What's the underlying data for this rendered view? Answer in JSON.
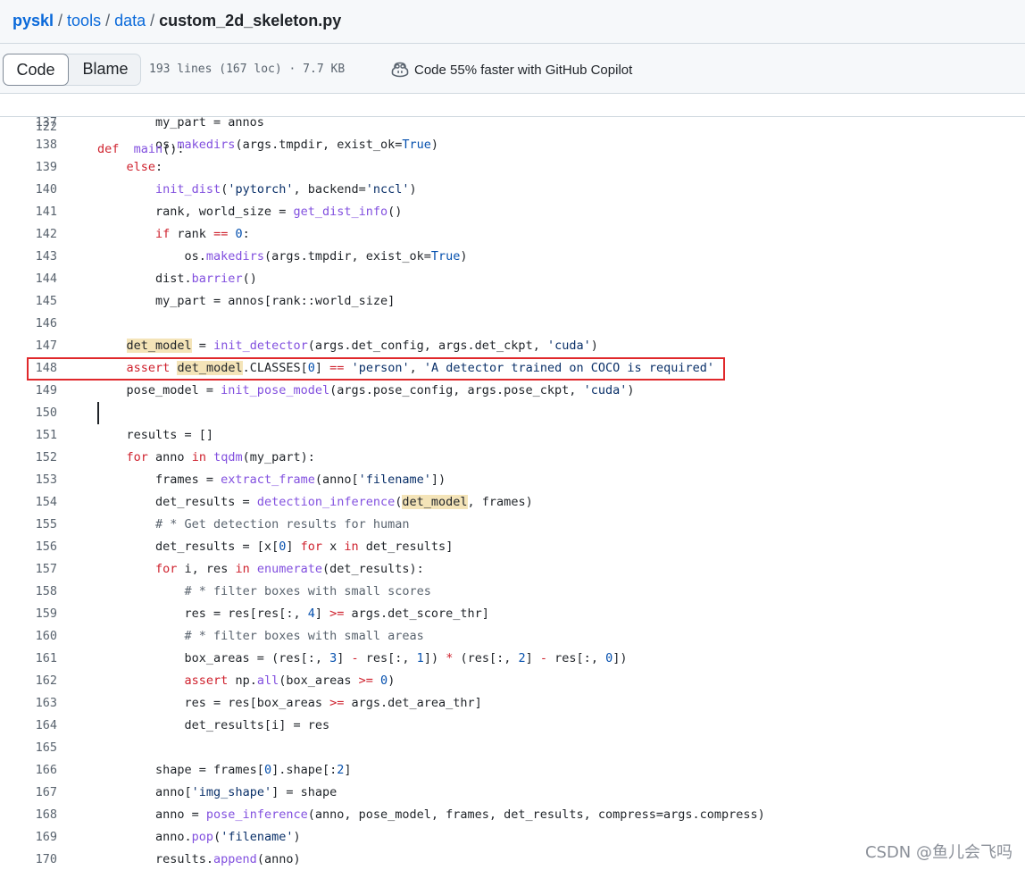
{
  "breadcrumb": {
    "repo": "pyskl",
    "folder1": "tools",
    "folder2": "data",
    "file": "custom_2d_skeleton.py",
    "separator": "/"
  },
  "toolbar": {
    "code_label": "Code",
    "blame_label": "Blame",
    "file_meta": "193 lines (167 loc) · 7.7 KB",
    "copilot_label": "Code 55% faster with GitHub Copilot"
  },
  "sticky_line": {
    "number": "122",
    "tokens": [
      [
        "kw",
        "def"
      ],
      [
        "",
        "  "
      ],
      [
        "fn",
        "main"
      ],
      [
        "",
        "():"
      ]
    ]
  },
  "lines": [
    {
      "n": "137",
      "tokens": [
        [
          "",
          "        my_part = annos"
        ]
      ]
    },
    {
      "n": "138",
      "tokens": [
        [
          "",
          "        os."
        ],
        [
          "fn",
          "makedirs"
        ],
        [
          "",
          "(args.tmpdir, exist_ok="
        ],
        [
          "const",
          "True"
        ],
        [
          "",
          ")"
        ]
      ]
    },
    {
      "n": "139",
      "tokens": [
        [
          "",
          "    "
        ],
        [
          "kw",
          "else"
        ],
        [
          "",
          ":"
        ]
      ]
    },
    {
      "n": "140",
      "tokens": [
        [
          "",
          "        "
        ],
        [
          "fn",
          "init_dist"
        ],
        [
          "",
          "("
        ],
        [
          "str",
          "'pytorch'"
        ],
        [
          "",
          ", backend="
        ],
        [
          "str",
          "'nccl'"
        ],
        [
          "",
          ")"
        ]
      ]
    },
    {
      "n": "141",
      "tokens": [
        [
          "",
          "        rank, world_size = "
        ],
        [
          "fn",
          "get_dist_info"
        ],
        [
          "",
          "()"
        ]
      ]
    },
    {
      "n": "142",
      "tokens": [
        [
          "",
          "        "
        ],
        [
          "kw",
          "if"
        ],
        [
          "",
          " rank "
        ],
        [
          "kw",
          "=="
        ],
        [
          "",
          " "
        ],
        [
          "const",
          "0"
        ],
        [
          "",
          ":"
        ]
      ]
    },
    {
      "n": "143",
      "tokens": [
        [
          "",
          "            os."
        ],
        [
          "fn",
          "makedirs"
        ],
        [
          "",
          "(args.tmpdir, exist_ok="
        ],
        [
          "const",
          "True"
        ],
        [
          "",
          ")"
        ]
      ]
    },
    {
      "n": "144",
      "tokens": [
        [
          "",
          "        dist."
        ],
        [
          "fn",
          "barrier"
        ],
        [
          "",
          "()"
        ]
      ]
    },
    {
      "n": "145",
      "tokens": [
        [
          "",
          "        my_part = annos[rank::world_size]"
        ]
      ]
    },
    {
      "n": "146",
      "tokens": []
    },
    {
      "n": "147",
      "tokens": [
        [
          "",
          "    "
        ],
        [
          "hl",
          "det_model"
        ],
        [
          "",
          " = "
        ],
        [
          "fn",
          "init_detector"
        ],
        [
          "",
          "(args.det_config, args.det_ckpt, "
        ],
        [
          "str",
          "'cuda'"
        ],
        [
          "",
          ")"
        ]
      ]
    },
    {
      "n": "148",
      "tokens": [
        [
          "",
          "    "
        ],
        [
          "kw",
          "assert"
        ],
        [
          "",
          " "
        ],
        [
          "hl",
          "det_model"
        ],
        [
          "",
          ".CLASSES["
        ],
        [
          "const",
          "0"
        ],
        [
          "",
          "] "
        ],
        [
          "kw",
          "=="
        ],
        [
          "",
          " "
        ],
        [
          "str",
          "'person'"
        ],
        [
          "",
          ", "
        ],
        [
          "str",
          "'A detector trained on COCO is required'"
        ]
      ]
    },
    {
      "n": "149",
      "tokens": [
        [
          "",
          "    pose_model = "
        ],
        [
          "fn",
          "init_pose_model"
        ],
        [
          "",
          "(args.pose_config, args.pose_ckpt, "
        ],
        [
          "str",
          "'cuda'"
        ],
        [
          "",
          ")"
        ]
      ]
    },
    {
      "n": "150",
      "tokens": []
    },
    {
      "n": "151",
      "tokens": [
        [
          "",
          "    results = []"
        ]
      ]
    },
    {
      "n": "152",
      "tokens": [
        [
          "",
          "    "
        ],
        [
          "kw",
          "for"
        ],
        [
          "",
          " anno "
        ],
        [
          "kw",
          "in"
        ],
        [
          "",
          " "
        ],
        [
          "fn",
          "tqdm"
        ],
        [
          "",
          "(my_part):"
        ]
      ]
    },
    {
      "n": "153",
      "tokens": [
        [
          "",
          "        frames = "
        ],
        [
          "fn",
          "extract_frame"
        ],
        [
          "",
          "(anno["
        ],
        [
          "str",
          "'filename'"
        ],
        [
          "",
          "])"
        ]
      ]
    },
    {
      "n": "154",
      "tokens": [
        [
          "",
          "        det_results = "
        ],
        [
          "fn",
          "detection_inference"
        ],
        [
          "",
          "("
        ],
        [
          "hl",
          "det_model"
        ],
        [
          "",
          ", frames)"
        ]
      ]
    },
    {
      "n": "155",
      "tokens": [
        [
          "",
          "        "
        ],
        [
          "com",
          "# * Get detection results for human"
        ]
      ]
    },
    {
      "n": "156",
      "tokens": [
        [
          "",
          "        det_results = [x["
        ],
        [
          "const",
          "0"
        ],
        [
          "",
          "] "
        ],
        [
          "kw",
          "for"
        ],
        [
          "",
          " x "
        ],
        [
          "kw",
          "in"
        ],
        [
          "",
          " det_results]"
        ]
      ]
    },
    {
      "n": "157",
      "tokens": [
        [
          "",
          "        "
        ],
        [
          "kw",
          "for"
        ],
        [
          "",
          " i, res "
        ],
        [
          "kw",
          "in"
        ],
        [
          "",
          " "
        ],
        [
          "fn",
          "enumerate"
        ],
        [
          "",
          "(det_results):"
        ]
      ]
    },
    {
      "n": "158",
      "tokens": [
        [
          "",
          "            "
        ],
        [
          "com",
          "# * filter boxes with small scores"
        ]
      ]
    },
    {
      "n": "159",
      "tokens": [
        [
          "",
          "            res = res[res[:, "
        ],
        [
          "const",
          "4"
        ],
        [
          "",
          "] "
        ],
        [
          "kw",
          ">="
        ],
        [
          "",
          " args.det_score_thr]"
        ]
      ]
    },
    {
      "n": "160",
      "tokens": [
        [
          "",
          "            "
        ],
        [
          "com",
          "# * filter boxes with small areas"
        ]
      ]
    },
    {
      "n": "161",
      "tokens": [
        [
          "",
          "            box_areas = (res[:, "
        ],
        [
          "const",
          "3"
        ],
        [
          "",
          "] "
        ],
        [
          "kw",
          "-"
        ],
        [
          "",
          " res[:, "
        ],
        [
          "const",
          "1"
        ],
        [
          "",
          "]) "
        ],
        [
          "kw",
          "*"
        ],
        [
          "",
          " (res[:, "
        ],
        [
          "const",
          "2"
        ],
        [
          "",
          "] "
        ],
        [
          "kw",
          "-"
        ],
        [
          "",
          " res[:, "
        ],
        [
          "const",
          "0"
        ],
        [
          "",
          "])"
        ]
      ]
    },
    {
      "n": "162",
      "tokens": [
        [
          "",
          "            "
        ],
        [
          "kw",
          "assert"
        ],
        [
          "",
          " np."
        ],
        [
          "fn",
          "all"
        ],
        [
          "",
          "(box_areas "
        ],
        [
          "kw",
          ">="
        ],
        [
          "",
          " "
        ],
        [
          "const",
          "0"
        ],
        [
          "",
          ")"
        ]
      ]
    },
    {
      "n": "163",
      "tokens": [
        [
          "",
          "            res = res[box_areas "
        ],
        [
          "kw",
          ">="
        ],
        [
          "",
          " args.det_area_thr]"
        ]
      ]
    },
    {
      "n": "164",
      "tokens": [
        [
          "",
          "            det_results[i] = res"
        ]
      ]
    },
    {
      "n": "165",
      "tokens": []
    },
    {
      "n": "166",
      "tokens": [
        [
          "",
          "        shape = frames["
        ],
        [
          "const",
          "0"
        ],
        [
          "",
          "].shape[:"
        ],
        [
          "const",
          "2"
        ],
        [
          "",
          "]"
        ]
      ]
    },
    {
      "n": "167",
      "tokens": [
        [
          "",
          "        anno["
        ],
        [
          "str",
          "'img_shape'"
        ],
        [
          "",
          "] = shape"
        ]
      ]
    },
    {
      "n": "168",
      "tokens": [
        [
          "",
          "        anno = "
        ],
        [
          "fn",
          "pose_inference"
        ],
        [
          "",
          "(anno, pose_model, frames, det_results, compress=args.compress)"
        ]
      ]
    },
    {
      "n": "169",
      "tokens": [
        [
          "",
          "        anno."
        ],
        [
          "fn",
          "pop"
        ],
        [
          "",
          "("
        ],
        [
          "str",
          "'filename'"
        ],
        [
          "",
          ")"
        ]
      ]
    },
    {
      "n": "170",
      "tokens": [
        [
          "",
          "        results."
        ],
        [
          "fn",
          "append"
        ],
        [
          "",
          "(anno)"
        ]
      ]
    }
  ],
  "watermark": "CSDN @鱼儿会飞吗",
  "colors": {
    "keyword": "#cf222e",
    "function": "#8250df",
    "string": "#0a3069",
    "constant": "#0550ae",
    "comment": "#59636e",
    "link": "#0969da",
    "symbol_highlight": "#f4e4b8",
    "annotation_box": "#e0282b"
  }
}
